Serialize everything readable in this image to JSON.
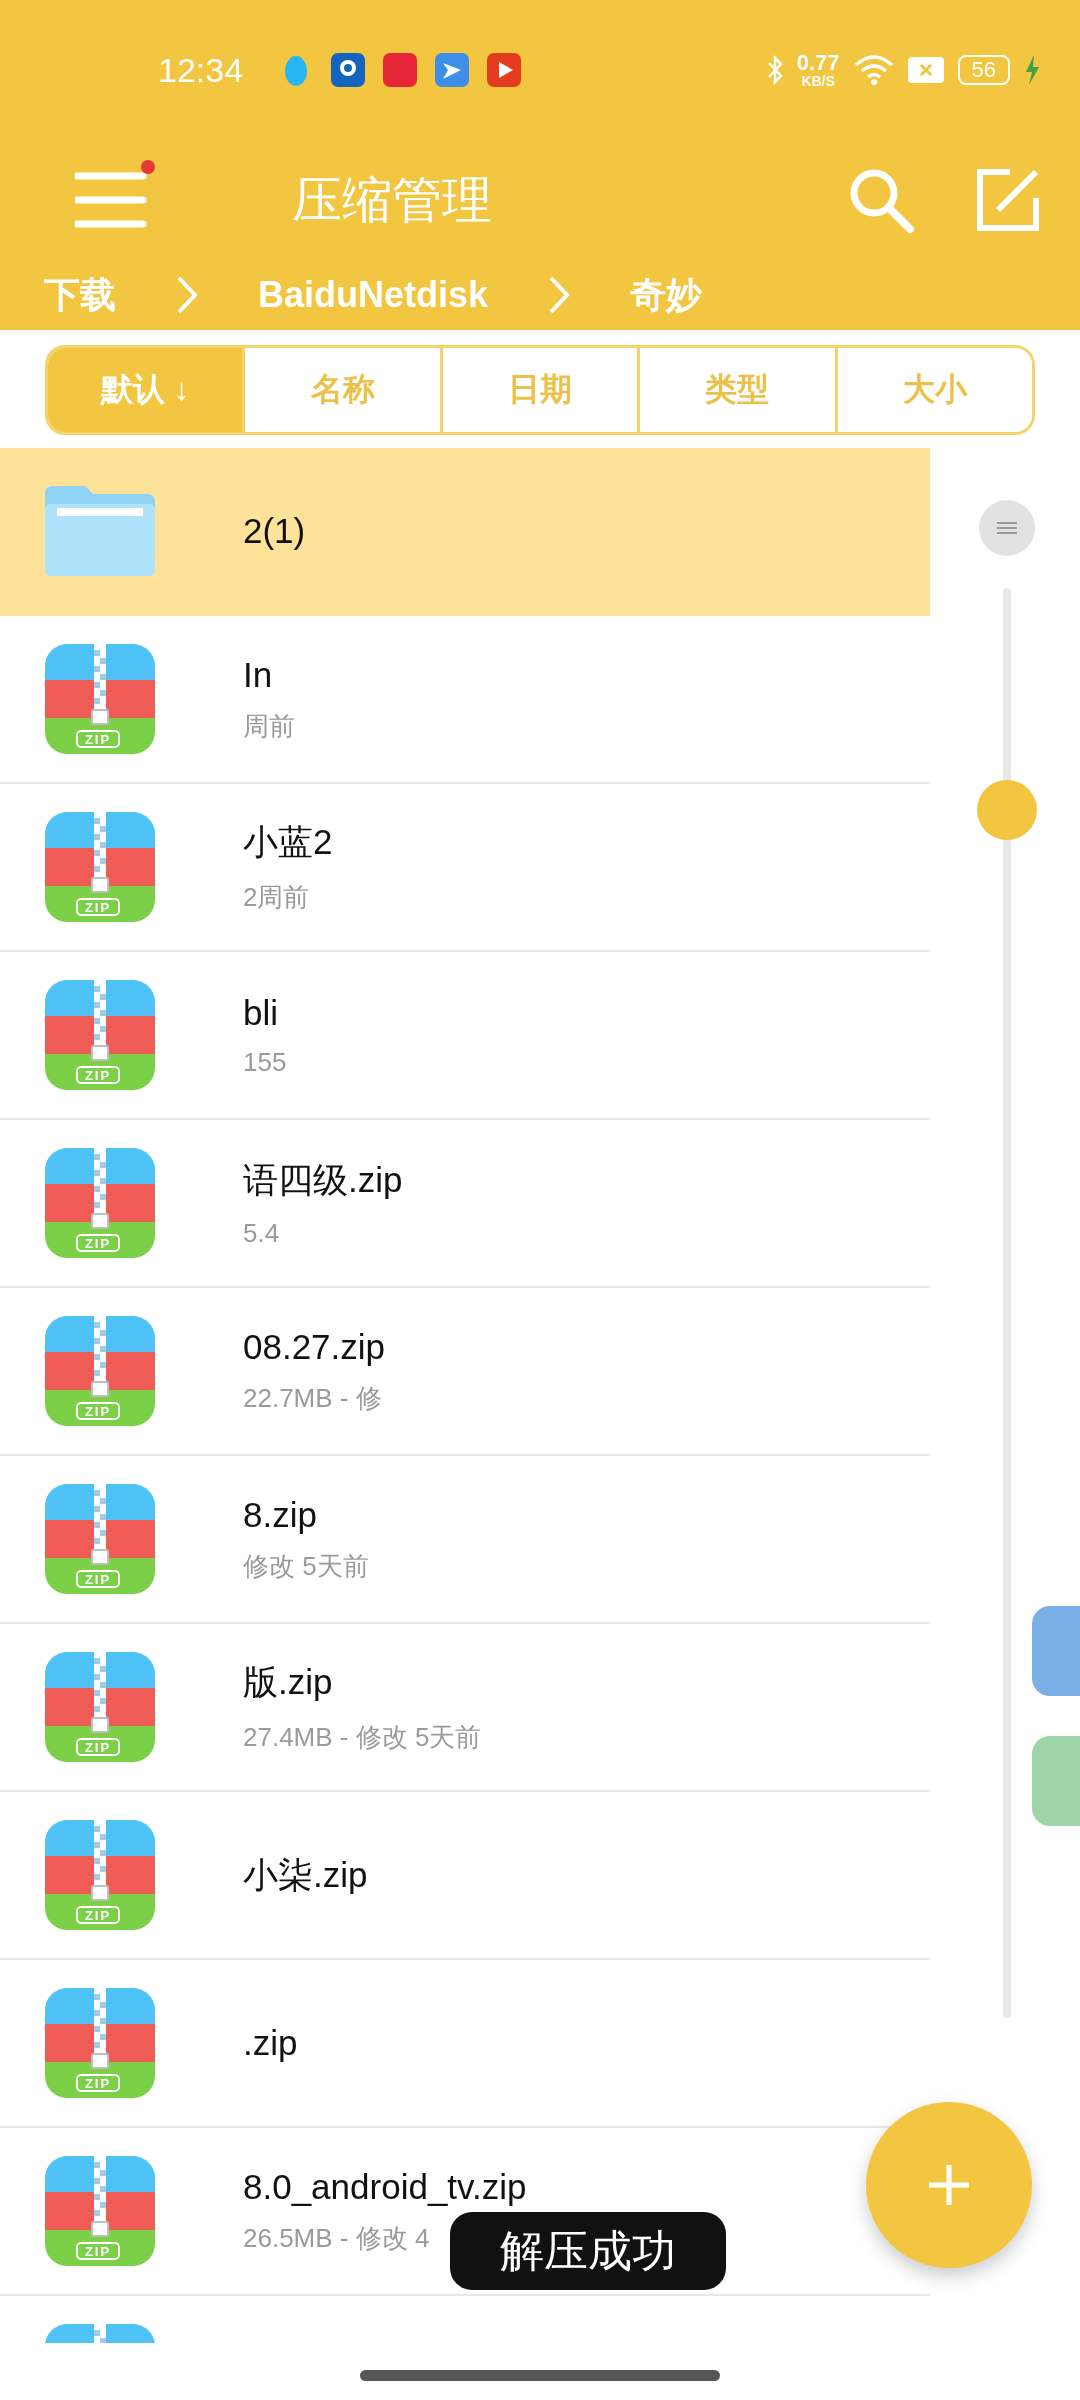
{
  "status_bar": {
    "time": "12:34",
    "net_speed": "0.77",
    "net_unit": "KB/S",
    "battery": "56",
    "charging": true
  },
  "toolbar": {
    "title": "压缩管理",
    "menu_badge": true
  },
  "breadcrumb": [
    "下载",
    "BaiduNetdisk",
    "奇妙"
  ],
  "sort_tabs": [
    {
      "label": "默认 ↓",
      "selected": true
    },
    {
      "label": "名称",
      "selected": false
    },
    {
      "label": "日期",
      "selected": false
    },
    {
      "label": "类型",
      "selected": false
    },
    {
      "label": "大小",
      "selected": false
    }
  ],
  "files": [
    {
      "kind": "folder",
      "name": "2(1)",
      "selected": true
    },
    {
      "kind": "zip",
      "icon_text": "ZIP",
      "name": "In",
      "meta": "周前",
      "selected": false
    },
    {
      "kind": "zip",
      "icon_text": "ZIP",
      "name": "小蓝2",
      "meta": "2周前",
      "selected": false
    },
    {
      "kind": "zip",
      "icon_text": "ZIP",
      "name": "bli",
      "meta": "155",
      "selected": false
    },
    {
      "kind": "zip",
      "icon_text": "ZIP",
      "name": "语四级.zip",
      "meta": "5.4",
      "selected": false
    },
    {
      "kind": "zip",
      "icon_text": "ZIP",
      "name": "08.27.zip",
      "meta": "22.7MB - 修",
      "selected": false
    },
    {
      "kind": "zip",
      "icon_text": "ZIP",
      "name": "8.zip",
      "meta": "修改 5天前",
      "selected": false
    },
    {
      "kind": "zip",
      "icon_text": "ZIP",
      "name": "版.zip",
      "meta": "27.4MB - 修改 5天前",
      "selected": false
    },
    {
      "kind": "zip",
      "icon_text": "ZIP",
      "name": "小柒.zip",
      "selected": false
    },
    {
      "kind": "zip",
      "icon_text": "ZIP",
      "name": ".zip",
      "selected": false
    },
    {
      "kind": "zip",
      "icon_text": "ZIP",
      "name": "8.0_android_tv.zip",
      "meta": "26.5MB - 修改 4",
      "selected": false
    },
    {
      "kind": "zip",
      "selected": false
    }
  ],
  "toast": "解压成功"
}
